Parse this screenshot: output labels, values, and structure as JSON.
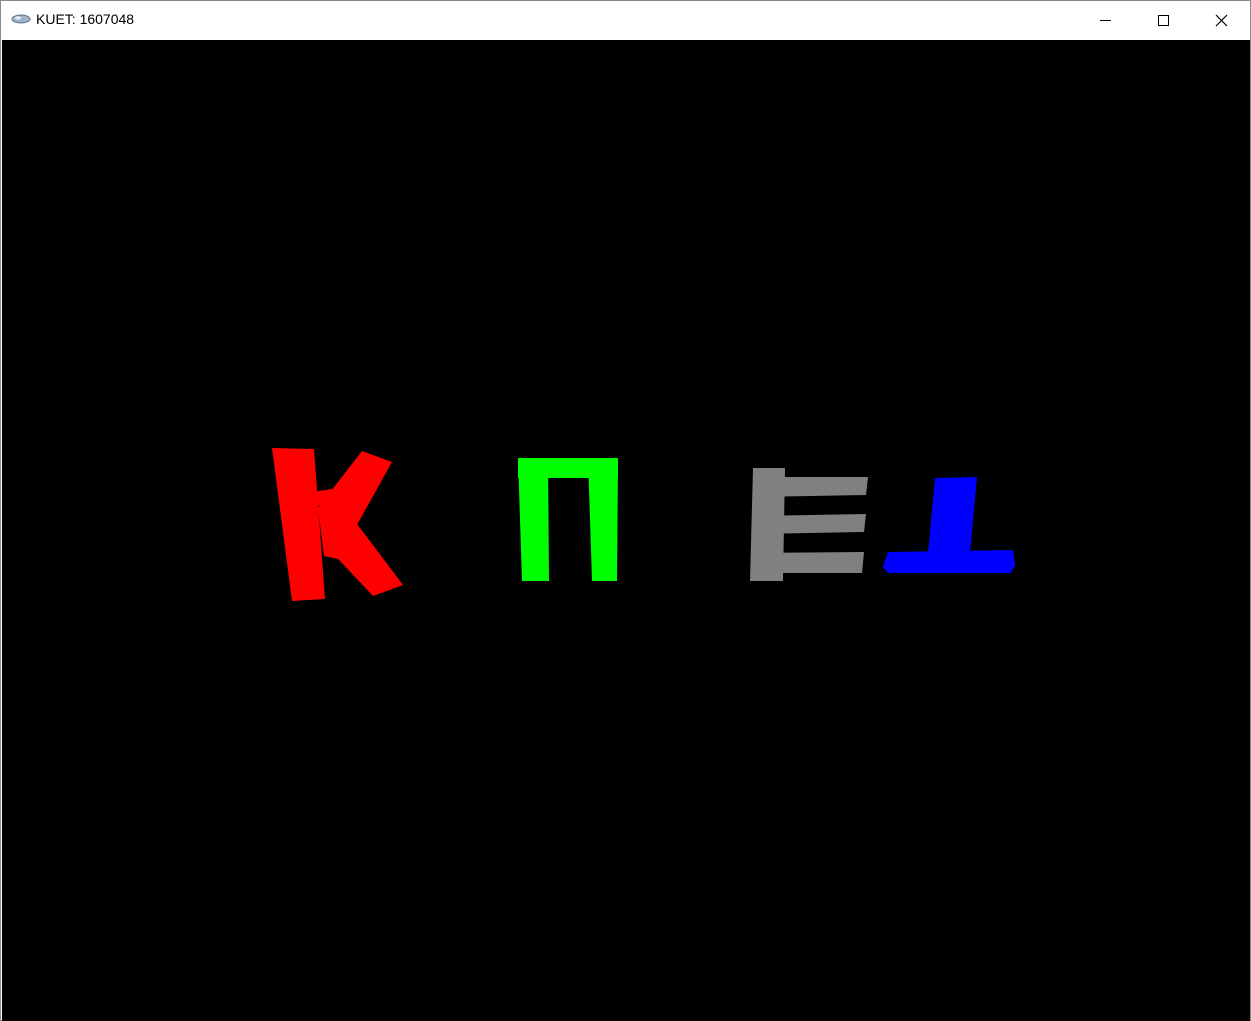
{
  "window": {
    "title": "KUET: 1607048",
    "app_icon": "opengl-app-icon",
    "controls": {
      "minimize_icon": "minimize-icon",
      "maximize_icon": "maximize-icon",
      "close_icon": "close-icon"
    }
  },
  "canvas": {
    "background_color": "#000000",
    "letters": [
      {
        "name": "letter-k",
        "color": "#ff0000"
      },
      {
        "name": "letter-u",
        "color": "#00ff00"
      },
      {
        "name": "letter-e",
        "color": "#808080"
      },
      {
        "name": "letter-t",
        "color": "#0000ff"
      }
    ]
  }
}
